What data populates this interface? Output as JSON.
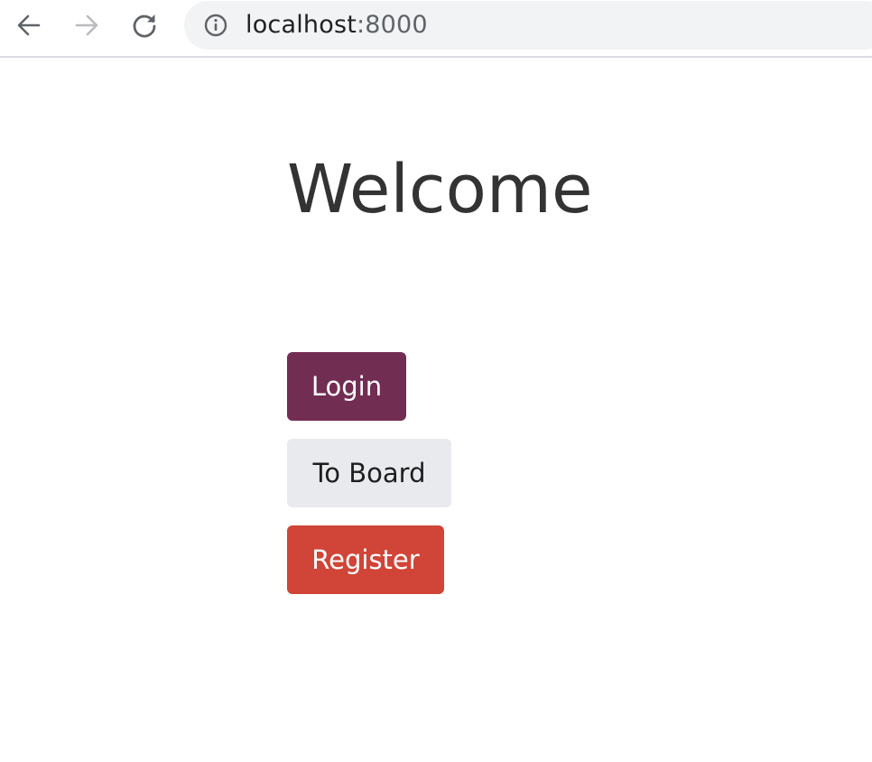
{
  "browser": {
    "url_host": "localhost",
    "url_port": ":8000",
    "icons": {
      "back": "arrow-left-icon",
      "forward": "arrow-right-icon",
      "reload": "reload-icon",
      "info": "info-circle-icon"
    }
  },
  "page": {
    "title": "Welcome",
    "buttons": {
      "login": "Login",
      "board": "To Board",
      "register": "Register"
    }
  },
  "colors": {
    "login": "#722d53",
    "board": "#e9eaee",
    "register": "#d04537",
    "title_text": "#333333"
  }
}
